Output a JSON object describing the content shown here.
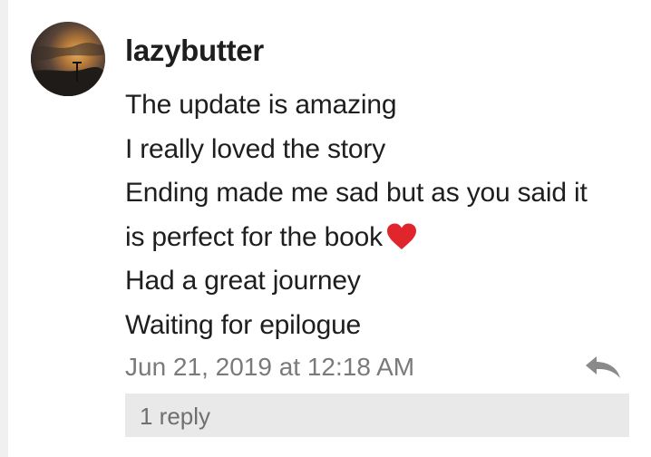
{
  "comment": {
    "username": "lazybutter",
    "lines": [
      "The update is amazing",
      "I really loved the story",
      "Ending made me sad but as you said it",
      "is perfect for the book",
      "Had a great journey",
      "Waiting for epilogue"
    ],
    "timestamp": "Jun 21, 2019 at 12:18 AM",
    "replies_label": "1 reply"
  },
  "icons": {
    "avatar": "avatar-photo-sunset",
    "heart": "red-heart-emoji",
    "reply": "reply-arrow-icon"
  },
  "colors": {
    "heart": "#e0262c",
    "timestamp": "#7a7a7a",
    "replies_bar": "#e9e9e9",
    "reply_icon": "#8a8a8a"
  }
}
